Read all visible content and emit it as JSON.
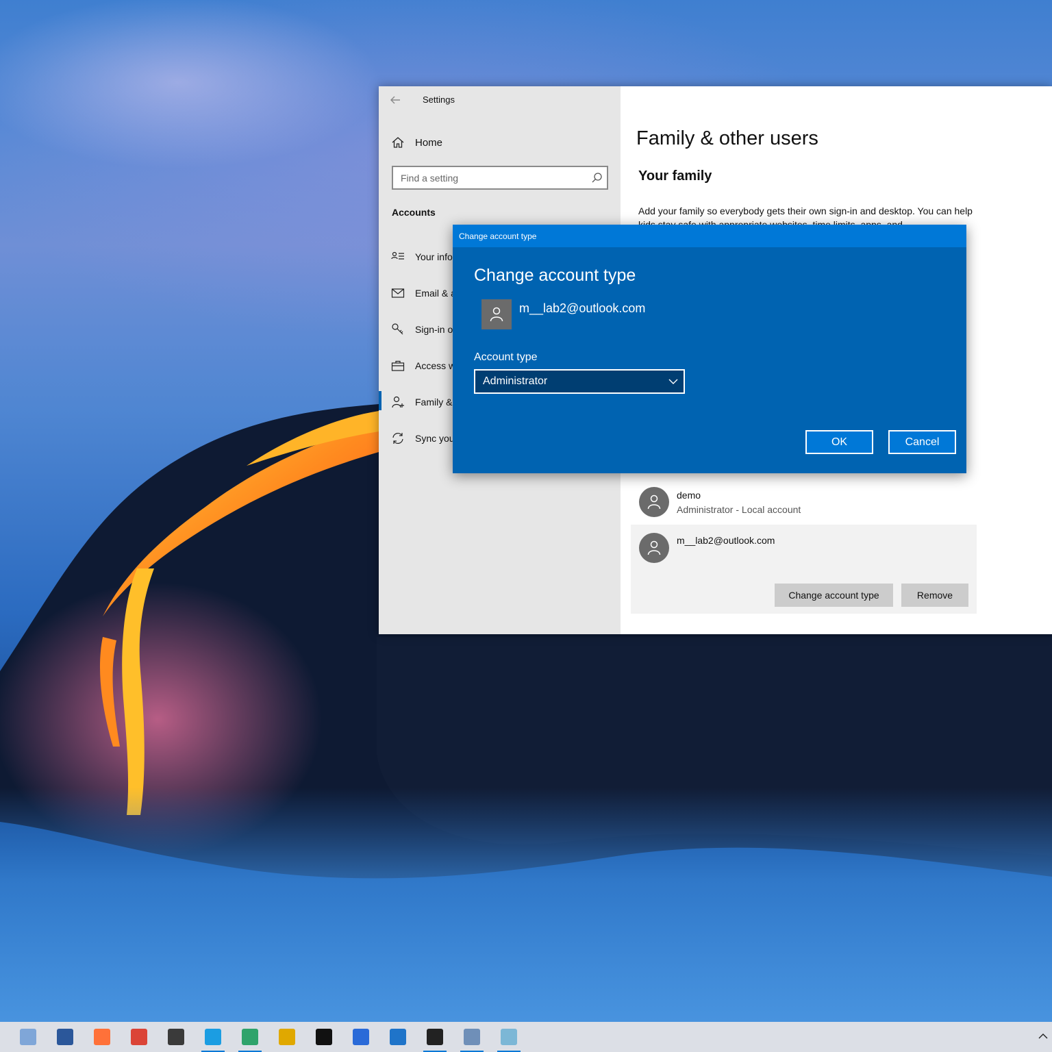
{
  "settings": {
    "window_title": "Settings",
    "nav": {
      "home": "Home",
      "search_placeholder": "Find a setting",
      "section": "Accounts",
      "items": [
        {
          "label": "Your info",
          "icon": "your-info-icon"
        },
        {
          "label": "Email & accounts",
          "icon": "mail-icon"
        },
        {
          "label": "Sign-in options",
          "icon": "key-icon"
        },
        {
          "label": "Access work or school",
          "icon": "briefcase-icon"
        },
        {
          "label": "Family & other users",
          "icon": "family-icon",
          "selected": true
        },
        {
          "label": "Sync your settings",
          "icon": "sync-icon"
        }
      ]
    },
    "content": {
      "title": "Family & other users",
      "family_heading": "Your family",
      "family_description": "Add your family so everybody gets their own sign-in and desktop. You can help kids stay safe with appropriate websites, time limits, apps, and",
      "users": [
        {
          "name": "demo",
          "subtitle": "Administrator - Local account"
        },
        {
          "name": "m__lab2@outlook.com",
          "subtitle": ""
        }
      ],
      "change_account_type_button": "Change account type",
      "remove_button": "Remove"
    }
  },
  "dialog": {
    "titlebar": "Change account type",
    "heading": "Change account type",
    "email": "m__lab2@outlook.com",
    "account_type_label": "Account type",
    "account_type_value": "Administrator",
    "ok": "OK",
    "cancel": "Cancel"
  },
  "taskbar": {
    "apps": [
      {
        "icon": "photos-icon",
        "color": "#7fa6d8",
        "active": false
      },
      {
        "icon": "word-icon",
        "color": "#2b579a",
        "active": false
      },
      {
        "icon": "firefox-icon",
        "color": "#ff7139",
        "active": false
      },
      {
        "icon": "chrome-icon",
        "color": "#db4437",
        "active": false
      },
      {
        "icon": "terminal-icon",
        "color": "#3a3a3a",
        "active": false
      },
      {
        "icon": "edge-icon",
        "color": "#1b9de2",
        "active": true
      },
      {
        "icon": "edge-beta-icon",
        "color": "#2fa36b",
        "active": true
      },
      {
        "icon": "edge-canary-icon",
        "color": "#e0a800",
        "active": false
      },
      {
        "icon": "command-prompt-icon",
        "color": "#111111",
        "active": false
      },
      {
        "icon": "powershell-icon",
        "color": "#2a6ad8",
        "active": false
      },
      {
        "icon": "image-viewer-icon",
        "color": "#1f74c9",
        "active": false
      },
      {
        "icon": "console-error-icon",
        "color": "#222222",
        "active": true
      },
      {
        "icon": "network-pc-icon",
        "color": "#6f8fb8",
        "active": true
      },
      {
        "icon": "notepad-icon",
        "color": "#7cb7d6",
        "active": true
      }
    ]
  },
  "colors": {
    "accent": "#0078d7",
    "dialog_bg": "#0063b1",
    "nav_bg": "#e6e6e6"
  }
}
